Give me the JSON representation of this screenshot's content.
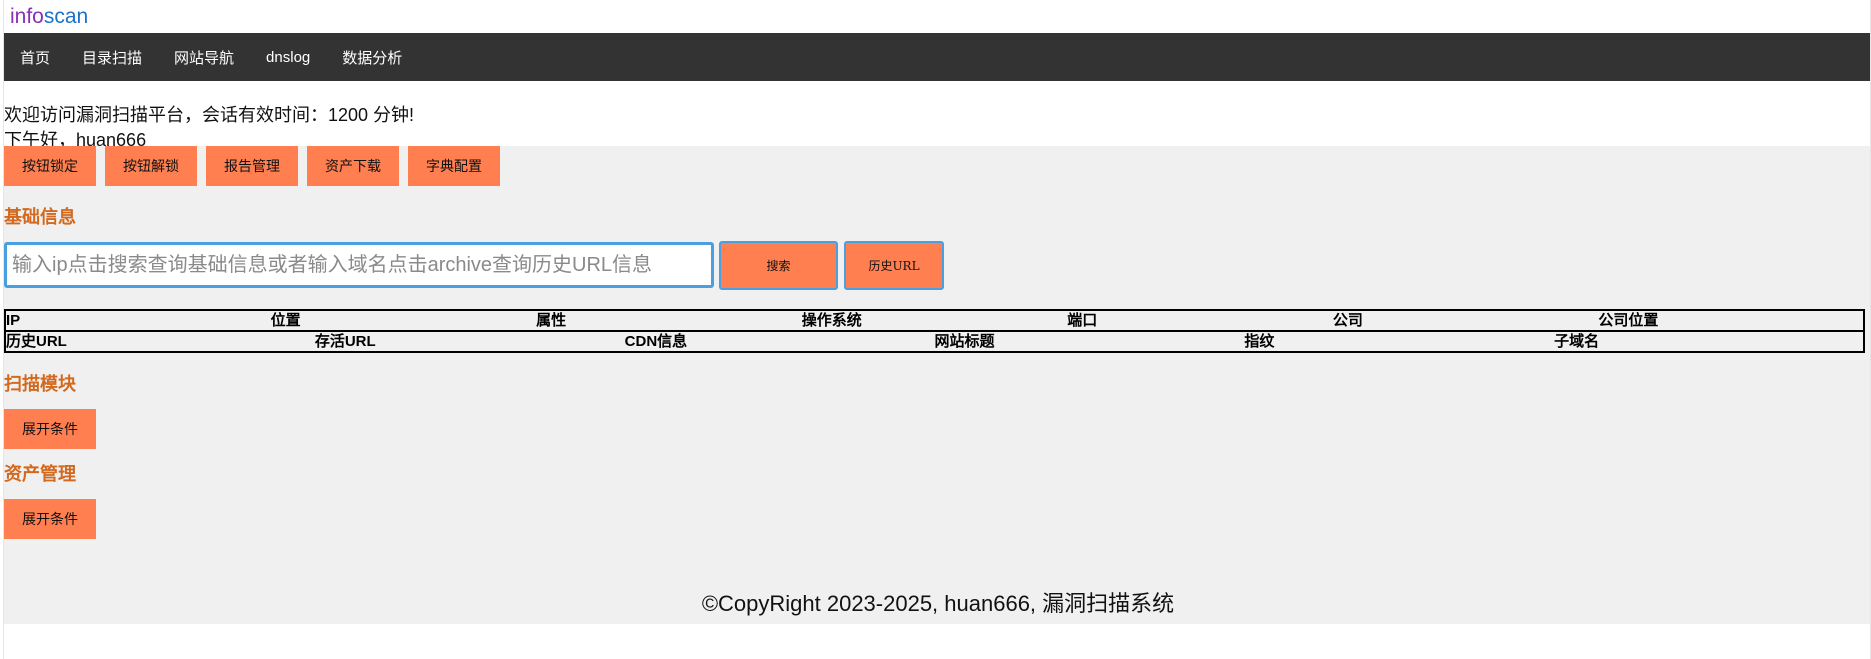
{
  "header": {
    "logo_part1": "info",
    "logo_part2": "scan"
  },
  "nav": {
    "items": [
      "首页",
      "目录扫描",
      "网站导航",
      "dnslog",
      "数据分析"
    ]
  },
  "welcome": {
    "line1": "欢迎访问漏洞扫描平台，会话有效时间：1200 分钟!",
    "line2": "下午好，huan666"
  },
  "toolbar": {
    "buttons": [
      "按钮锁定",
      "按钮解锁",
      "报告管理",
      "资产下载",
      "字典配置"
    ]
  },
  "basic_info": {
    "title": "基础信息",
    "search_placeholder": "输入ip点击搜索查询基础信息或者输入域名点击archive查询历史URL信息",
    "search_button": "搜索",
    "history_button": "历史URL",
    "table1_headers": [
      "IP",
      "位置",
      "属性",
      "操作系统",
      "端口",
      "公司",
      "公司位置"
    ],
    "table2_headers": [
      "历史URL",
      "存活URL",
      "CDN信息",
      "网站标题",
      "指纹",
      "子域名"
    ]
  },
  "scan_module": {
    "title": "扫描模块",
    "expand_button": "展开条件"
  },
  "asset_management": {
    "title": "资产管理",
    "expand_button": "展开条件"
  },
  "footer": {
    "text": "©CopyRight 2023-2025, huan666, 漏洞扫描系统"
  },
  "colors": {
    "accent_button": "#ff7f50",
    "section_title": "#d2691e",
    "navbar": "#333333",
    "background": "#f0f0f0",
    "input_border": "#4a9fe0"
  }
}
